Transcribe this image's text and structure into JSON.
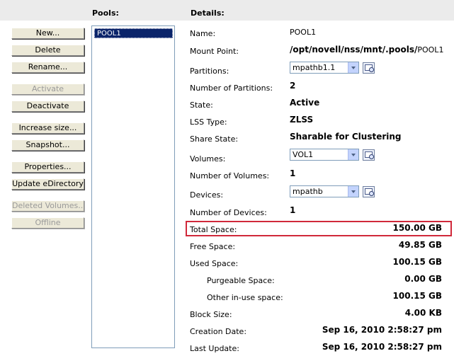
{
  "headers": {
    "pools": "Pools:",
    "details": "Details:"
  },
  "buttons": {
    "new": "New...",
    "delete": "Delete",
    "rename": "Rename...",
    "activate": "Activate",
    "deactivate": "Deactivate",
    "increase_size": "Increase size...",
    "snapshot": "Snapshot...",
    "properties": "Properties...",
    "update_edirectory": "Update eDirectory",
    "deleted_volumes": "Deleted Volumes...",
    "offline": "Offline"
  },
  "pools": [
    {
      "label": "POOL1"
    }
  ],
  "details": {
    "name": {
      "label": "Name:",
      "value": "POOL1"
    },
    "mount_point": {
      "label": "Mount Point:",
      "value": "/opt/novell/nss/mnt/.pools/",
      "suffix": "POOL1"
    },
    "partitions": {
      "label": "Partitions:",
      "value": "mpathb1.1"
    },
    "num_partitions": {
      "label": "Number of Partitions:",
      "value": "2"
    },
    "state": {
      "label": "State:",
      "value": "Active"
    },
    "lss_type": {
      "label": "LSS Type:",
      "value": "ZLSS"
    },
    "share_state": {
      "label": "Share State:",
      "value": "Sharable for Clustering"
    },
    "volumes": {
      "label": "Volumes:",
      "value": "VOL1"
    },
    "num_volumes": {
      "label": "Number of Volumes:",
      "value": "1"
    },
    "devices": {
      "label": "Devices:",
      "value": "mpathb"
    },
    "num_devices": {
      "label": "Number of Devices:",
      "value": "1"
    },
    "total_space": {
      "label": "Total Space:",
      "value": "150.00 GB"
    },
    "free_space": {
      "label": "Free Space:",
      "value": "49.85 GB"
    },
    "used_space": {
      "label": "Used Space:",
      "value": "100.15 GB"
    },
    "purgeable_space": {
      "label": "Purgeable Space:",
      "value": "0.00 GB"
    },
    "other_inuse_space": {
      "label": "Other in-use space:",
      "value": "100.15 GB"
    },
    "block_size": {
      "label": "Block Size:",
      "value": "4.00 KB"
    },
    "creation_date": {
      "label": "Creation Date:",
      "value": "Sep 16, 2010 2:58:27 pm"
    },
    "last_update": {
      "label": "Last Update:",
      "value": "Sep 16, 2010 2:58:27 pm"
    }
  },
  "colors": {
    "highlight_border": "#d0283a",
    "selection_bg": "#0a246a",
    "header_bg": "#ebebeb"
  }
}
